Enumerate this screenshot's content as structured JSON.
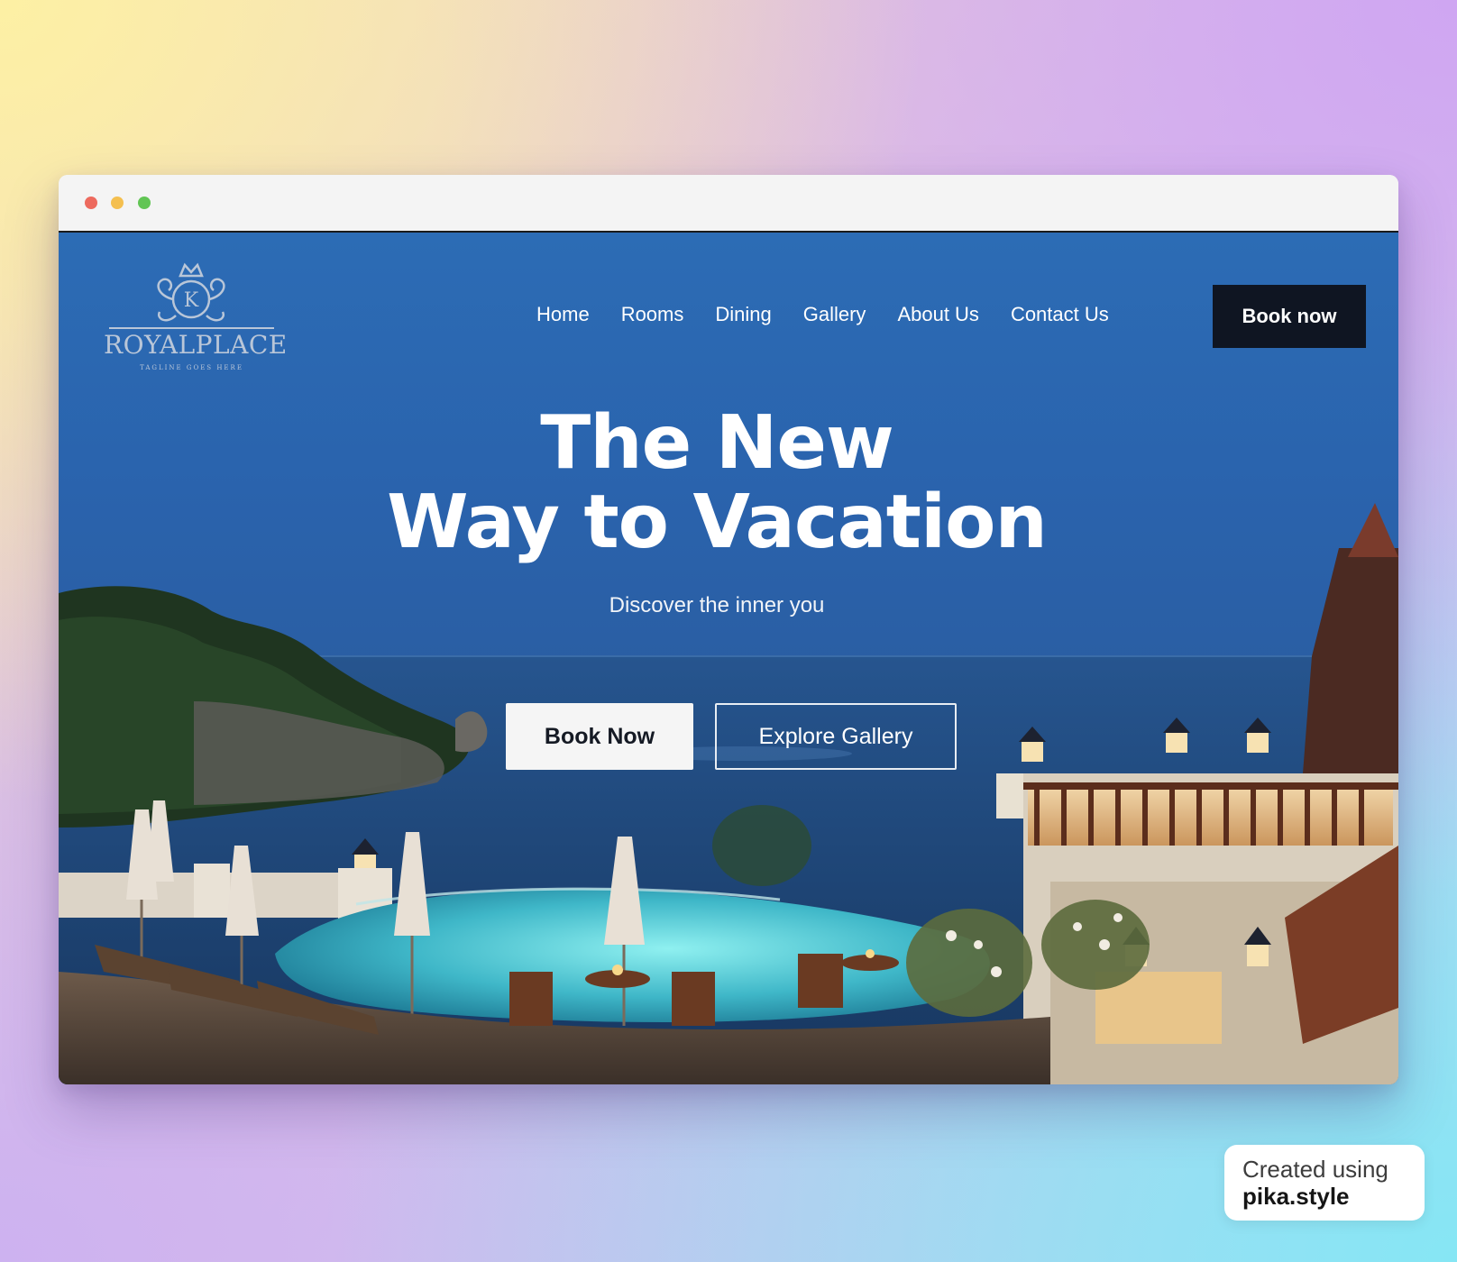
{
  "brand": {
    "monogram": "K",
    "name": "ROYALPLACE",
    "tagline": "TAGLINE GOES HERE"
  },
  "nav": {
    "items": [
      "Home",
      "Rooms",
      "Dining",
      "Gallery",
      "About Us",
      "Contact Us"
    ],
    "cta": "Book now"
  },
  "hero": {
    "title_line1": "The New",
    "title_line2": "Way to Vacation",
    "subtitle": "Discover the inner you",
    "primary_button": "Book Now",
    "secondary_button": "Explore Gallery"
  },
  "watermark": {
    "line1": "Created using",
    "line2": "pika.style"
  },
  "colors": {
    "sky": "#2c6cb5",
    "nav_button": "#0f1522",
    "traffic_red": "#ed6a5e",
    "traffic_yellow": "#f4bf4f",
    "traffic_green": "#61c554"
  }
}
